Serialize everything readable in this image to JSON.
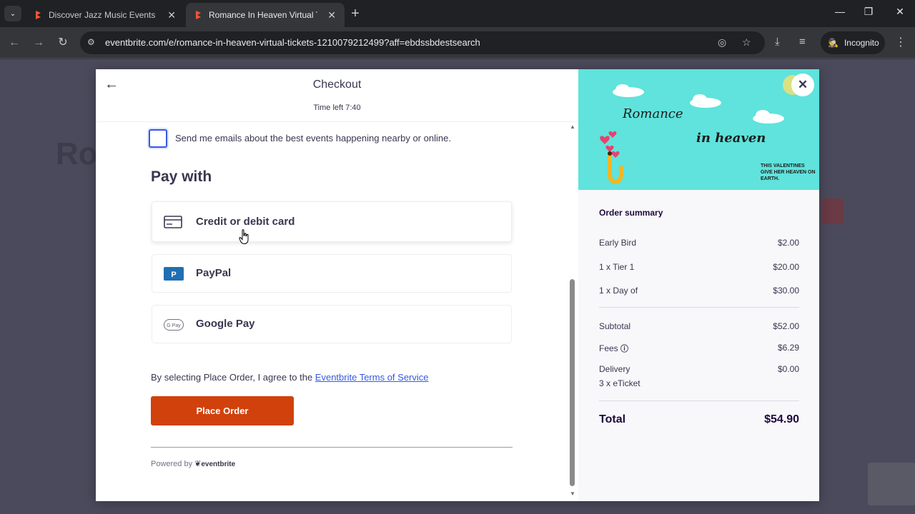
{
  "browser": {
    "tabs": [
      {
        "title": "Discover Jazz Music Events & A",
        "active": false
      },
      {
        "title": "Romance In Heaven Virtual Tick",
        "active": true
      }
    ],
    "url": "eventbrite.com/e/romance-in-heaven-virtual-tickets-1210079212499?aff=ebdssbdestsearch",
    "profile_label": "Incognito"
  },
  "background_page": {
    "title_fragment": "Ro"
  },
  "checkout": {
    "title": "Checkout",
    "timer": "Time left 7:40",
    "email_opt_in_label": "Send me emails about the best events happening nearby or online.",
    "pay_heading": "Pay with",
    "payment_options": [
      {
        "label": "Credit or debit card",
        "icon": "credit-card-icon"
      },
      {
        "label": "PayPal",
        "icon": "paypal-icon"
      },
      {
        "label": "Google Pay",
        "icon": "google-pay-icon"
      }
    ],
    "terms_prefix": "By selecting Place Order, I agree to the ",
    "terms_link": "Eventbrite Terms of Service",
    "place_order_label": "Place Order",
    "powered_by": "Powered by",
    "powered_logo": "eventbrite"
  },
  "banner": {
    "line1": "Romance",
    "line2": "in heaven",
    "tagline": "THIS VALENTINES GIVE HER HEAVEN ON EARTH."
  },
  "order_summary": {
    "title": "Order summary",
    "items": [
      {
        "label": "Early Bird",
        "value": "$2.00"
      },
      {
        "label": "1 x Tier 1",
        "value": "$20.00"
      },
      {
        "label": "1 x Day of",
        "value": "$30.00"
      }
    ],
    "subtotal_label": "Subtotal",
    "subtotal_value": "$52.00",
    "fees_label": "Fees",
    "fees_value": "$6.29",
    "delivery_label": "Delivery",
    "delivery_value": "$0.00",
    "delivery_detail": "3 x eTicket",
    "total_label": "Total",
    "total_value": "$54.90"
  },
  "colors": {
    "brand_orange": "#d1410c",
    "link_blue": "#3659e3",
    "banner_teal": "#5fe3dc"
  }
}
